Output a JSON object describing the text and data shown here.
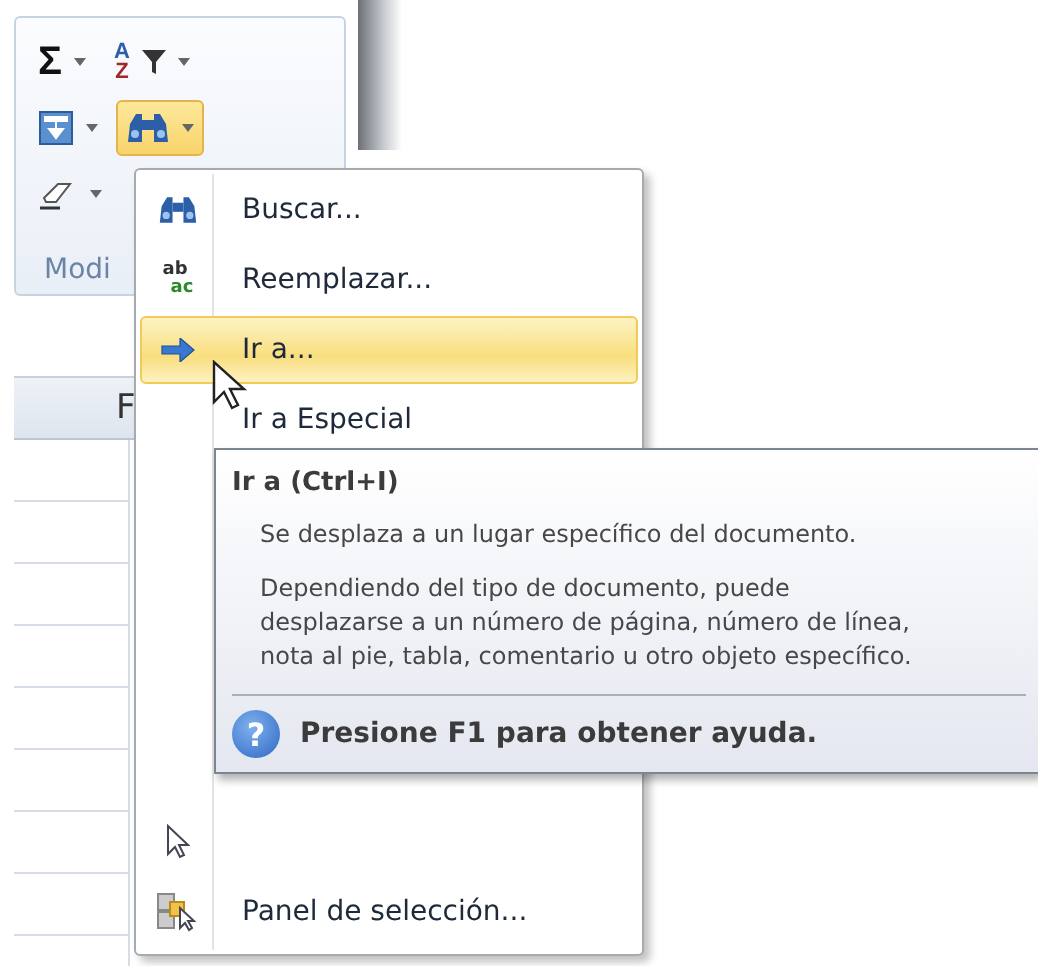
{
  "ribbon": {
    "buttons": [
      {
        "kind": "sum",
        "glyph": "Σ",
        "selected": false
      },
      {
        "kind": "sort-filter",
        "glyphs": [
          "A",
          "Z"
        ],
        "selected": false
      },
      {
        "kind": "fill",
        "selected": false
      },
      {
        "kind": "find",
        "selected": true
      },
      {
        "kind": "clear",
        "selected": false
      }
    ],
    "group_label": "Modi"
  },
  "sheet": {
    "column_header": "F"
  },
  "menu": {
    "items": [
      {
        "kind": "find",
        "label": "Buscar...",
        "selected": false
      },
      {
        "kind": "replace",
        "glyphs": [
          "ab",
          "ac"
        ],
        "label": "Reemplazar...",
        "selected": false
      },
      {
        "kind": "goto",
        "label": "Ir a...",
        "selected": true
      },
      {
        "kind": "plain",
        "label": "Ir a Especial",
        "selected": false
      },
      {
        "kind": "select-objects",
        "selected": false
      },
      {
        "kind": "selection-pane",
        "label": "Panel de selección...",
        "selected": false
      }
    ]
  },
  "tooltip": {
    "title": "Ir a (Ctrl+I)",
    "paragraphs": [
      "Se desplaza a un lugar específico del documento.",
      "Dependiendo del tipo de documento, puede desplazarse a un número de página, número de línea, nota al pie, tabla, comentario u otro objeto específico."
    ],
    "help_glyph": "?",
    "help_text": "Presione F1 para obtener ayuda."
  }
}
